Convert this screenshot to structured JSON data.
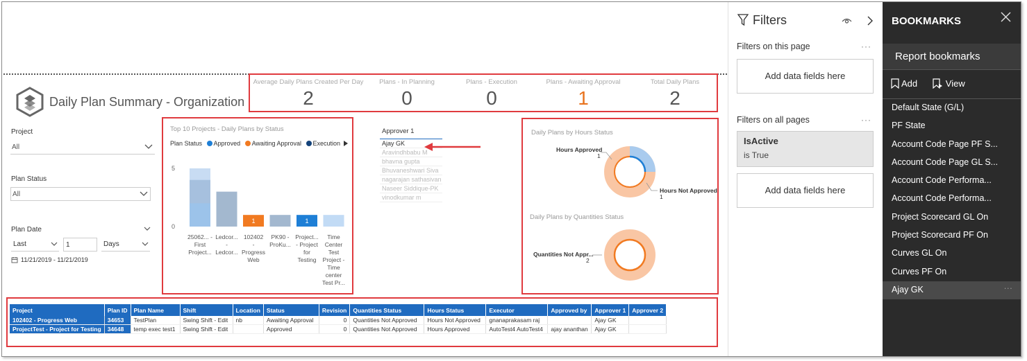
{
  "report": {
    "title": "Daily Plan Summary - Organization"
  },
  "kpis": [
    {
      "label": "Average Daily Plans Created Per Day",
      "value": "2"
    },
    {
      "label": "Plans - In Planning",
      "value": "0"
    },
    {
      "label": "Plans - Execution",
      "value": "0"
    },
    {
      "label": "Plans - Awaiting Approval",
      "value": "1"
    },
    {
      "label": "Total Daily Plans",
      "value": "2"
    }
  ],
  "slicers": {
    "project": {
      "label": "Project",
      "value": "All"
    },
    "plan_status": {
      "label": "Plan Status",
      "value": "All"
    },
    "plan_date": {
      "label": "Plan Date",
      "mode": "Last",
      "count": "1",
      "unit": "Days",
      "range": "11/21/2019 - 11/21/2019"
    }
  },
  "approver_slicer": {
    "header": "Approver 1",
    "items": [
      "Ajay GK",
      "Aravindhbabu M",
      "bhavna gupta",
      "Bhuvaneshwari Siva",
      "nagarajan sathasivan",
      "Naseer Siddique-PK",
      "vinodkumar m"
    ]
  },
  "colors": {
    "approved": "#1e7fd6",
    "awaiting": "#f17a21",
    "execution": "#14437a",
    "highlight_red": "#e03a3e",
    "accent_blue": "#1f6bc0"
  },
  "chart_data": [
    {
      "type": "bar",
      "title": "Top 10 Projects - Daily Plans by Status",
      "legend_title": "Plan Status",
      "legend": [
        "Approved",
        "Awaiting Approval",
        "Execution"
      ],
      "ylim": [
        0,
        5
      ],
      "yticks": [
        "5",
        "0"
      ],
      "categories": [
        "25062... - First Project...",
        "Ledcor... - Ledcor...",
        "102402 - Progress Web",
        "PK90 - ProKu...",
        "Project... - Project for Testing",
        "Time Center Test Project - Time center Test Pr..."
      ],
      "values": [
        5,
        3,
        1,
        1,
        1,
        1
      ],
      "data_labels": [
        "",
        "",
        "1",
        "",
        "1",
        ""
      ]
    },
    {
      "type": "pie",
      "title": "Daily Plans by Hours Status",
      "slices": [
        {
          "name": "Hours Approved",
          "value": 1,
          "label": "Hours Approved",
          "count": "1"
        },
        {
          "name": "Hours Not Approved",
          "value": 1,
          "label": "Hours Not Approved",
          "count": "1"
        }
      ]
    },
    {
      "type": "pie",
      "title": "Daily Plans by Quantities Status",
      "slices": [
        {
          "name": "Quantities Not Approved",
          "value": 2,
          "label": "Quantities Not Appr...",
          "count": "2"
        }
      ]
    }
  ],
  "table": {
    "columns": [
      "Project",
      "Plan ID",
      "Plan Name",
      "Shift",
      "Location",
      "Status",
      "Revision",
      "Quantities Status",
      "Hours Status",
      "Executor",
      "Approved by",
      "Approver 1",
      "Approver 2"
    ],
    "rows": [
      [
        "102402 - Progress Web",
        "34653",
        "TestPlan",
        "Swing Shift - Edit",
        "nb",
        "Awaiting Approval",
        "0",
        "Quantities Not Approved",
        "Hours Not Approved",
        "gnanaprakasam raj",
        "",
        "Ajay GK",
        ""
      ],
      [
        "ProjectTest - Project for Testing",
        "34648",
        "temp exec test1",
        "Swing Shift - Edit",
        "",
        "Approved",
        "0",
        "Quantities Not Approved",
        "Hours Approved",
        "AutoTest4 AutoTest4",
        "ajay ananthan",
        "Ajay GK",
        ""
      ]
    ]
  },
  "filters_pane": {
    "title": "Filters",
    "on_page": "Filters on this page",
    "on_all": "Filters on all pages",
    "add_fields": "Add data fields here",
    "active_filter": {
      "name": "IsActive",
      "value": "is True"
    }
  },
  "bookmarks_pane": {
    "title": "BOOKMARKS",
    "subtitle": "Report bookmarks",
    "add_label": "Add",
    "view_label": "View",
    "items": [
      "Default State (G/L)",
      "PF State",
      "Account Code Page PF S...",
      "Account Code Page GL S...",
      "Account Code Performa...",
      "Account Code Performa...",
      "Project Scorecard GL On",
      "Project Scorecard PF On",
      "Curves GL On",
      "Curves PF On",
      "Ajay GK"
    ],
    "selected_index": 10
  }
}
